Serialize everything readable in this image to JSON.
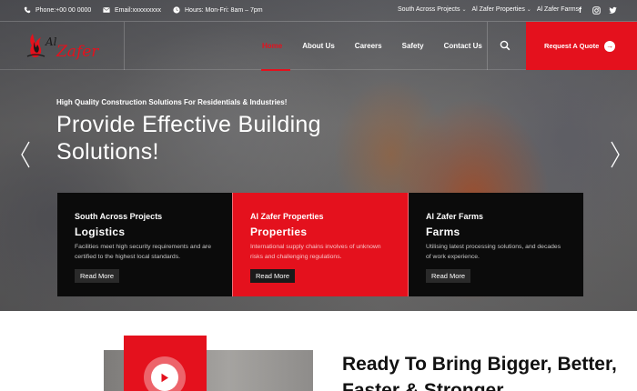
{
  "topbar": {
    "phone": "Phone:+00 00 0000",
    "email": "Email:xxxxxxxxx",
    "hours": "Hours: Mon-Fri: 8am – 7pm",
    "links": [
      {
        "label": "South Across Projects",
        "has_caret": true
      },
      {
        "label": "Al Zafer Properties",
        "has_caret": true
      },
      {
        "label": "Al Zafer Farms",
        "has_caret": false
      }
    ],
    "social_icons": [
      "facebook-icon",
      "instagram-icon",
      "twitter-icon"
    ]
  },
  "brand": {
    "logo_text": "Al Zafer",
    "accent_color": "#e4111d"
  },
  "nav": {
    "items": [
      {
        "label": "Home",
        "active": true
      },
      {
        "label": "About Us",
        "active": false
      },
      {
        "label": "Careers",
        "active": false
      },
      {
        "label": "Safety",
        "active": false
      },
      {
        "label": "Contact Us",
        "active": false
      }
    ],
    "search_icon": "search-icon",
    "quote_label": "Request A Quote"
  },
  "hero": {
    "tagline": "High Quality Construction Solutions For Residentials & Industries!",
    "headline": "Provide Effective Building Solutions!"
  },
  "cards": [
    {
      "subtitle": "South Across Projects",
      "title": "Logistics",
      "description": "Facilities meet high security requirements and are certified to the highest local standards.",
      "button": "Read More"
    },
    {
      "subtitle": "Al Zafer Properties",
      "title": "Properties",
      "description": "International supply chains involves of unknown risks and challenging regulations.",
      "button": "Read More"
    },
    {
      "subtitle": "Al Zafer Farms",
      "title": "Farms",
      "description": "Utilising latest processing solutions, and decades of work experience.",
      "button": "Read More"
    }
  ],
  "about": {
    "heading": "Ready To Bring Bigger, Better, Faster & Stronger"
  }
}
